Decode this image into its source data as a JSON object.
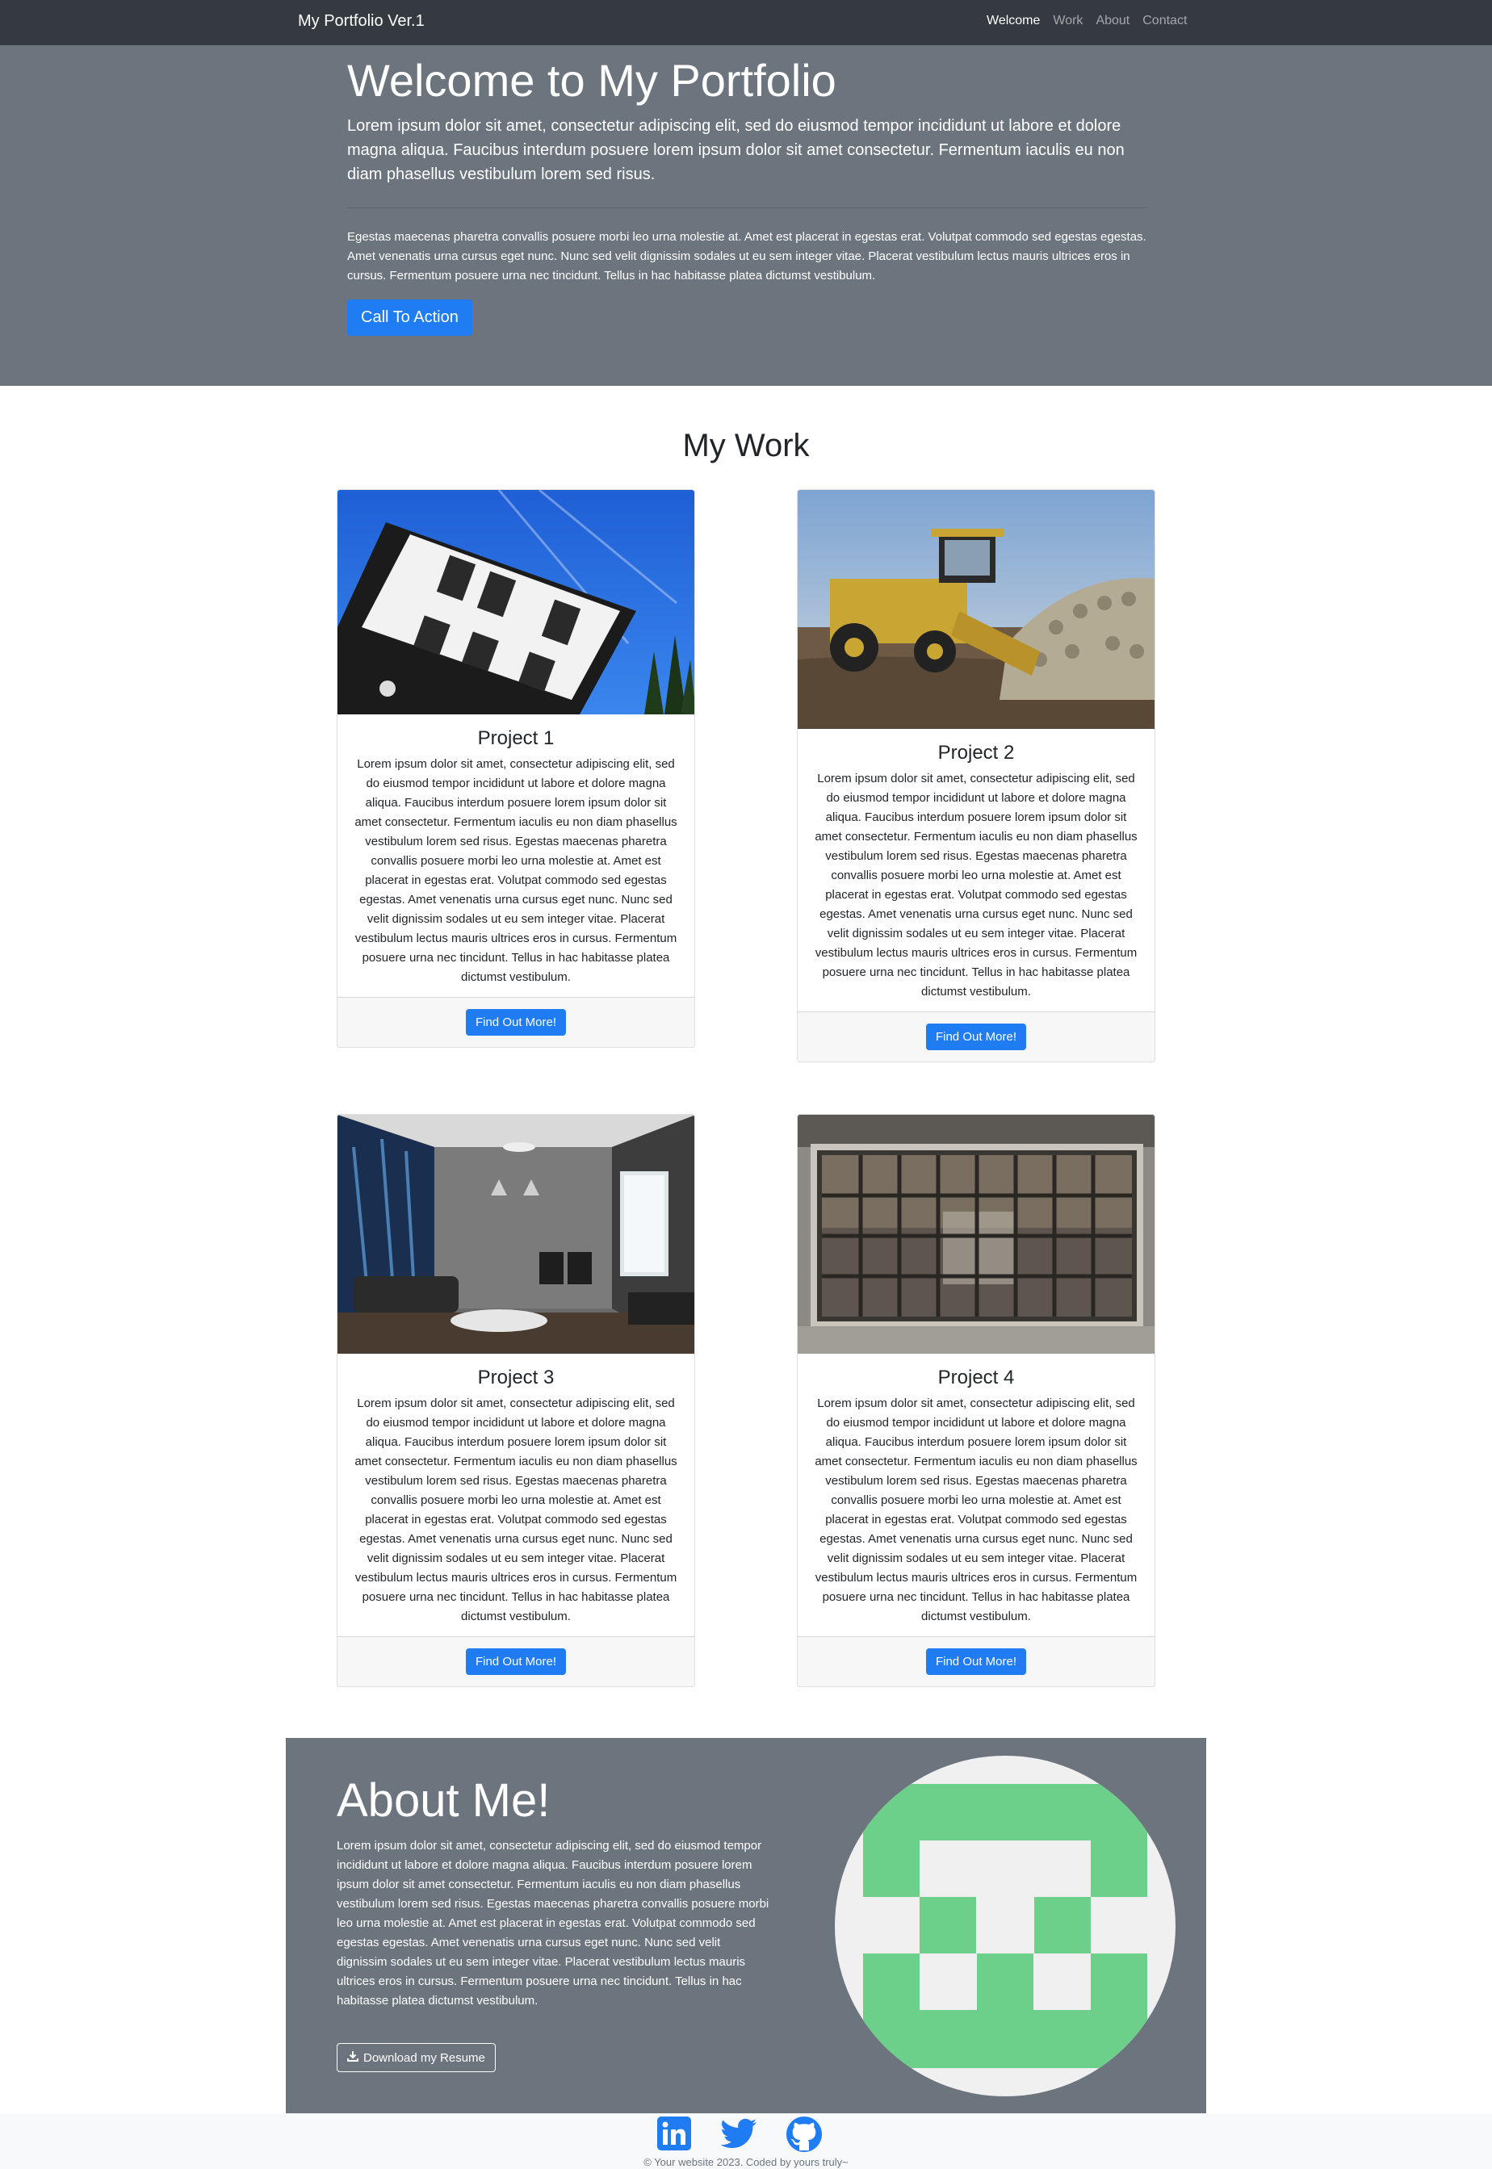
{
  "navbar": {
    "brand": "My Portfolio Ver.1",
    "links": [
      {
        "label": "Welcome",
        "active": true
      },
      {
        "label": "Work",
        "active": false
      },
      {
        "label": "About",
        "active": false
      },
      {
        "label": "Contact",
        "active": false
      }
    ]
  },
  "hero": {
    "title": "Welcome to My Portfolio",
    "lead": "Lorem ipsum dolor sit amet, consectetur adipiscing elit, sed do eiusmod tempor incididunt ut labore et dolore magna aliqua. Faucibus interdum posuere lorem ipsum dolor sit amet consectetur. Fermentum iaculis eu non diam phasellus vestibulum lorem sed risus.",
    "body": "Egestas maecenas pharetra convallis posuere morbi leo urna molestie at. Amet est placerat in egestas erat. Volutpat commodo sed egestas egestas. Amet venenatis urna cursus eget nunc. Nunc sed velit dignissim sodales ut eu sem integer vitae. Placerat vestibulum lectus mauris ultrices eros in cursus. Fermentum posuere urna nec tincidunt. Tellus in hac habitasse platea dictumst vestibulum.",
    "cta_label": "Call To Action"
  },
  "work": {
    "title": "My Work",
    "projects": [
      {
        "title": "Project 1",
        "text": "Lorem ipsum dolor sit amet, consectetur adipiscing elit, sed do eiusmod tempor incididunt ut labore et dolore magna aliqua. Faucibus interdum posuere lorem ipsum dolor sit amet consectetur. Fermentum iaculis eu non diam phasellus vestibulum lorem sed risus. Egestas maecenas pharetra convallis posuere morbi leo urna molestie at. Amet est placerat in egestas erat. Volutpat commodo sed egestas egestas. Amet venenatis urna cursus eget nunc. Nunc sed velit dignissim sodales ut eu sem integer vitae. Placerat vestibulum lectus mauris ultrices eros in cursus. Fermentum posuere urna nec tincidunt. Tellus in hac habitasse platea dictumst vestibulum.",
        "button": "Find Out More!",
        "image": "upside-down-house-photo"
      },
      {
        "title": "Project 2",
        "text": "Lorem ipsum dolor sit amet, consectetur adipiscing elit, sed do eiusmod tempor incididunt ut labore et dolore magna aliqua. Faucibus interdum posuere lorem ipsum dolor sit amet consectetur. Fermentum iaculis eu non diam phasellus vestibulum lorem sed risus. Egestas maecenas pharetra convallis posuere morbi leo urna molestie at. Amet est placerat in egestas erat. Volutpat commodo sed egestas egestas. Amet venenatis urna cursus eget nunc. Nunc sed velit dignissim sodales ut eu sem integer vitae. Placerat vestibulum lectus mauris ultrices eros in cursus. Fermentum posuere urna nec tincidunt. Tellus in hac habitasse platea dictumst vestibulum.",
        "button": "Find Out More!",
        "image": "harvester-machine-photo"
      },
      {
        "title": "Project 3",
        "text": "Lorem ipsum dolor sit amet, consectetur adipiscing elit, sed do eiusmod tempor incididunt ut labore et dolore magna aliqua. Faucibus interdum posuere lorem ipsum dolor sit amet consectetur. Fermentum iaculis eu non diam phasellus vestibulum lorem sed risus. Egestas maecenas pharetra convallis posuere morbi leo urna molestie at. Amet est placerat in egestas erat. Volutpat commodo sed egestas egestas. Amet venenatis urna cursus eget nunc. Nunc sed velit dignissim sodales ut eu sem integer vitae. Placerat vestibulum lectus mauris ultrices eros in cursus. Fermentum posuere urna nec tincidunt. Tellus in hac habitasse platea dictumst vestibulum.",
        "button": "Find Out More!",
        "image": "living-room-photo"
      },
      {
        "title": "Project 4",
        "text": "Lorem ipsum dolor sit amet, consectetur adipiscing elit, sed do eiusmod tempor incididunt ut labore et dolore magna aliqua. Faucibus interdum posuere lorem ipsum dolor sit amet consectetur. Fermentum iaculis eu non diam phasellus vestibulum lorem sed risus. Egestas maecenas pharetra convallis posuere morbi leo urna molestie at. Amet est placerat in egestas erat. Volutpat commodo sed egestas egestas. Amet venenatis urna cursus eget nunc. Nunc sed velit dignissim sodales ut eu sem integer vitae. Placerat vestibulum lectus mauris ultrices eros in cursus. Fermentum posuere urna nec tincidunt. Tellus in hac habitasse platea dictumst vestibulum.",
        "button": "Find Out More!",
        "image": "old-window-photo"
      }
    ]
  },
  "about": {
    "title": "About Me!",
    "text": "Lorem ipsum dolor sit amet, consectetur adipiscing elit, sed do eiusmod tempor incididunt ut labore et dolore magna aliqua. Faucibus interdum posuere lorem ipsum dolor sit amet consectetur. Fermentum iaculis eu non diam phasellus vestibulum lorem sed risus. Egestas maecenas pharetra convallis posuere morbi leo urna molestie at. Amet est placerat in egestas erat. Volutpat commodo sed egestas egestas. Amet venenatis urna cursus eget nunc. Nunc sed velit dignissim sodales ut eu sem integer vitae. Placerat vestibulum lectus mauris ultrices eros in cursus. Fermentum posuere urna nec tincidunt. Tellus in hac habitasse platea dictumst vestibulum.",
    "resume_button": "Download my Resume",
    "avatar": "identicon-avatar"
  },
  "footer": {
    "socials": [
      "linkedin-icon",
      "twitter-icon",
      "github-icon"
    ],
    "text": "© Your website 2023. Coded by yours truly~"
  },
  "colors": {
    "navbar": "#343a40",
    "hero": "#6c757d",
    "primary": "#1f7cf2",
    "social": "#1f7cf2",
    "identicon_green": "#6ccf8a",
    "identicon_bg": "#f0f0f0"
  }
}
